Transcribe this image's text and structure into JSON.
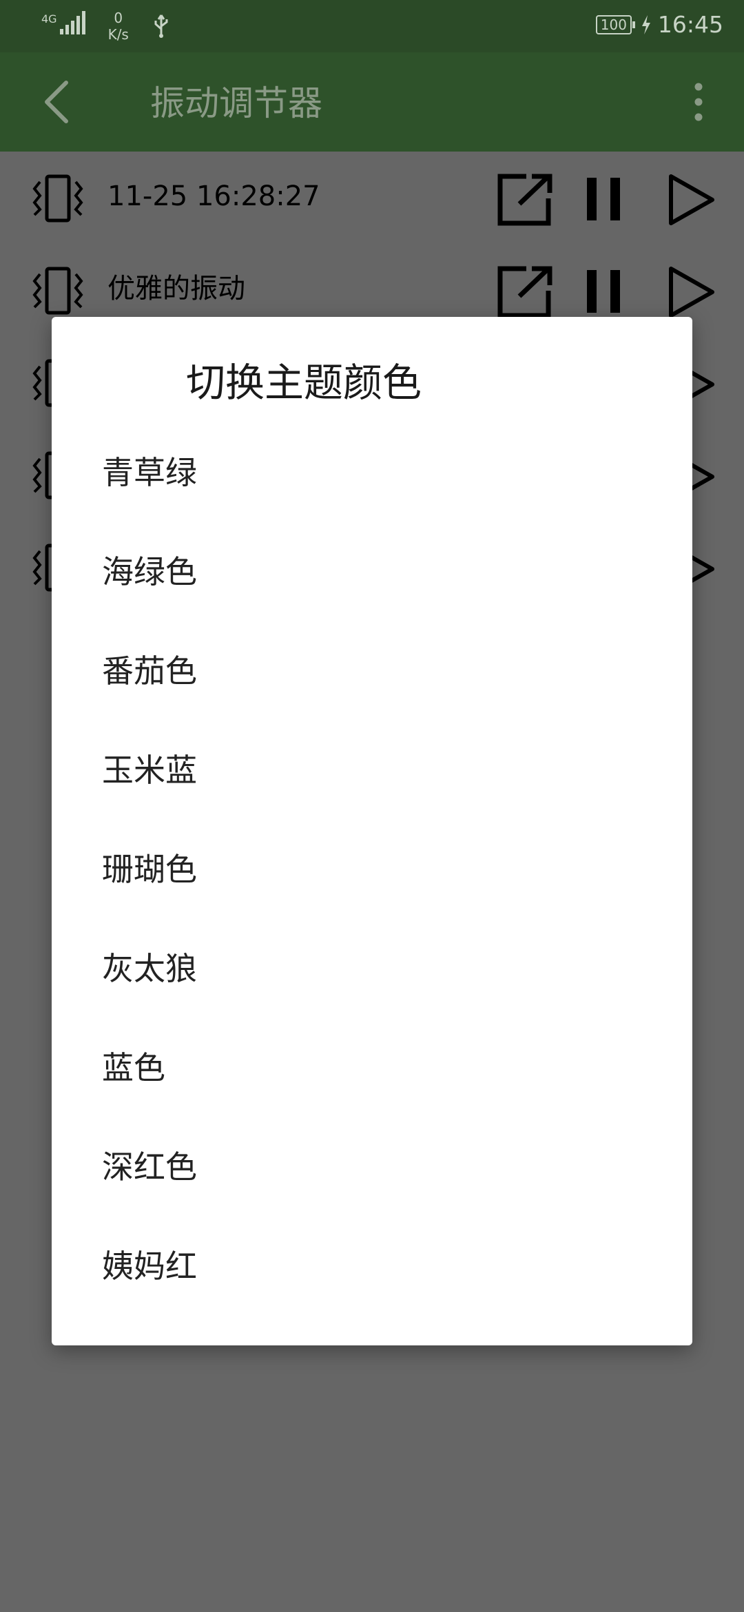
{
  "status_bar": {
    "network": "4G",
    "speed_value": "0",
    "speed_unit": "K/s",
    "battery": "100",
    "time": "16:45"
  },
  "app_bar": {
    "title": "振动调节器",
    "back_icon": "back-arrow-icon",
    "menu_icon": "more-vert-icon"
  },
  "vibrations": [
    {
      "label": "11-25 16:28:27"
    },
    {
      "label": "优雅的振动"
    },
    {
      "label": ""
    },
    {
      "label": ""
    },
    {
      "label": ""
    }
  ],
  "dialog": {
    "title": "切换主题颜色",
    "options": [
      "青草绿",
      "海绿色",
      "番茄色",
      "玉米蓝",
      "珊瑚色",
      "灰太狼",
      "蓝色",
      "深红色",
      "姨妈红"
    ]
  },
  "colors": {
    "status_bar": "#2b4a27",
    "app_bar": "#2e522a",
    "scrim_background": "#666666",
    "dialog_background": "#ffffff"
  }
}
